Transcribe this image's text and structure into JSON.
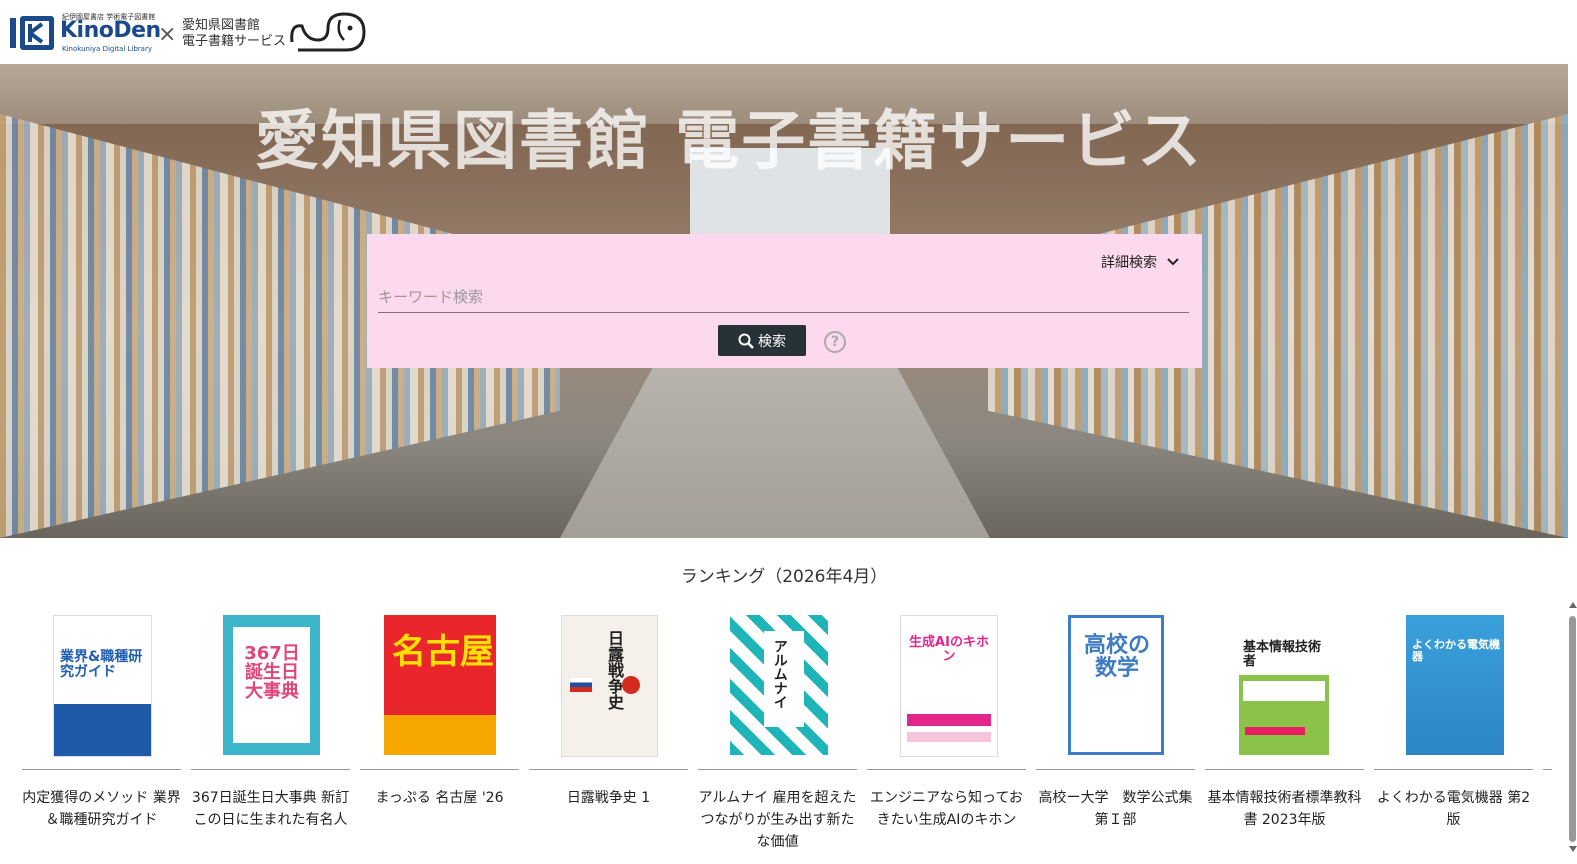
{
  "header": {
    "kinoden_small": "紀伊國屋書店 学術電子図書館",
    "kinoden_logo": "KinoDen",
    "kinoden_sub": "Kinokuniya Digital Library",
    "times": "×",
    "library_line1": "愛知県図書館",
    "library_line2": "電子書籍サービス"
  },
  "hero": {
    "title": "愛知県図書館 電子書籍サービス"
  },
  "search": {
    "advanced_label": "詳細検索",
    "placeholder": "キーワード検索",
    "value": "",
    "button_label": "検索",
    "help": "?"
  },
  "ranking": {
    "title": "ランキング（2026年4月）",
    "books": [
      {
        "title": "内定獲得のメソッド 業界＆職種研究ガイド",
        "cover_text": "業界&職種研究ガイド",
        "color": "#ffffff",
        "accent": "#1f5fb0"
      },
      {
        "title": "367日誕生日大事典 新訂 この日に生まれた有名人",
        "cover_text": "367日誕生日大事典",
        "color": "#3cb6c8",
        "accent": "#e0457b"
      },
      {
        "title": "まっぷる 名古屋 '26",
        "cover_text": "名古屋",
        "color": "#e8262b",
        "accent": "#ffe100"
      },
      {
        "title": "日露戦争史 1",
        "cover_text": "日露戦争史",
        "color": "#f5f1ea",
        "accent": "#222222"
      },
      {
        "title": "アルムナイ 雇用を超えたつながりが生み出す新たな価値",
        "cover_text": "アルムナイ",
        "color": "#ffffff",
        "accent": "#1fb5b8"
      },
      {
        "title": "エンジニアなら知っておきたい生成AIのキホン",
        "cover_text": "生成AIのキホン",
        "color": "#ffffff",
        "accent": "#e2268c"
      },
      {
        "title": "高校ー大学　数学公式集 第Ｉ部",
        "cover_text": "高校の数学",
        "color": "#ffffff",
        "accent": "#3e7cc4"
      },
      {
        "title": "基本情報技術者標準教科書 2023年版",
        "cover_text": "基本情報技術者",
        "color": "#8bc34a",
        "accent": "#e91e63"
      },
      {
        "title": "よくわかる電気機器 第2版",
        "cover_text": "よくわかる電気機器",
        "color": "#3aa0dc",
        "accent": "#ffffff"
      }
    ]
  }
}
